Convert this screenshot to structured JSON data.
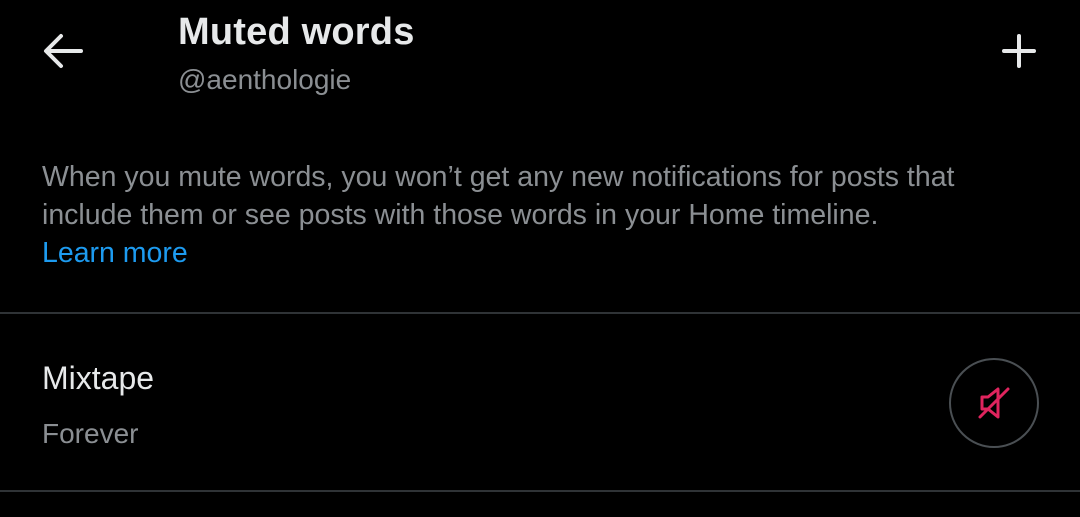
{
  "header": {
    "title": "Muted words",
    "handle": "@aenthologie"
  },
  "icons": {
    "back": "arrow-left-icon",
    "add": "plus-icon",
    "unmute": "speaker-muted-icon"
  },
  "description": {
    "text": "When you mute words, you won’t get any new notifications for posts that include them or see posts with those words in your Home timeline.",
    "link_label": "Learn more"
  },
  "muted_words": [
    {
      "word": "Mixtape",
      "duration": "Forever"
    }
  ],
  "colors": {
    "background": "#000000",
    "primary_text": "#e7e9ea",
    "secondary_text": "#8b8f93",
    "link": "#1d9bf0",
    "mute_icon": "#e0245e",
    "divider": "#2f3336"
  }
}
